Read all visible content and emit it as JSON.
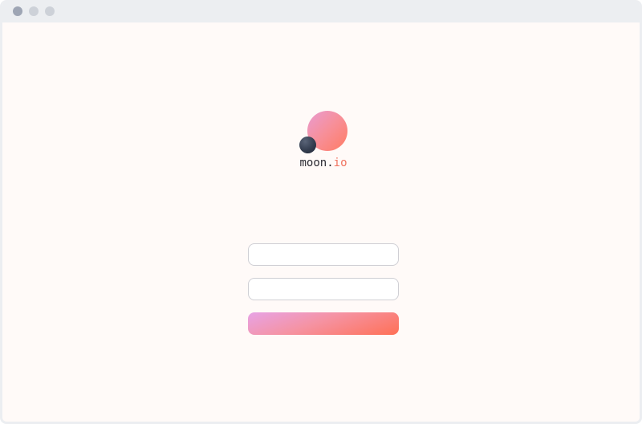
{
  "window": {
    "controls": [
      "close",
      "minimize",
      "maximize"
    ]
  },
  "brand": {
    "name_prefix": "moon.",
    "name_suffix": "io",
    "logo_icons": [
      "planet-icon",
      "moon-icon"
    ]
  },
  "login_form": {
    "username_value": "",
    "username_placeholder": "",
    "password_value": "",
    "password_placeholder": "",
    "submit_label": ""
  },
  "colors": {
    "background": "#fffaf8",
    "titlebar": "#eceef1",
    "accent": "#f0725f",
    "gradient_start": "#e99cd2",
    "gradient_end": "#ff7b63",
    "moon_dark": "#343d4f",
    "field_border": "#cfcfd4"
  }
}
